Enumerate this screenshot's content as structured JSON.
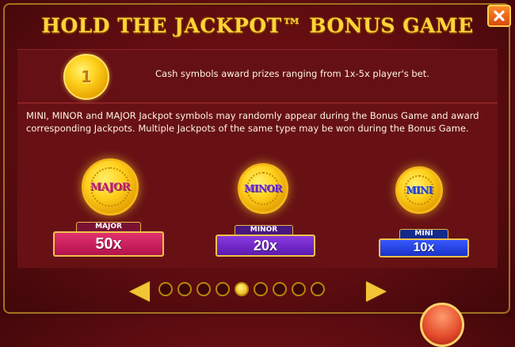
{
  "title": "HOLD THE JACKPOT™ BONUS GAME",
  "close_icon": "close-icon",
  "cash_coin": {
    "value": "1",
    "text": "Cash symbols award prizes ranging from 1x-5x player's bet."
  },
  "description": "MINI, MINOR and MAJOR Jackpot symbols may randomly appear during the Bonus Game and award corresponding Jackpots. Multiple Jackpots of the same type may be won during the Bonus Game.",
  "jackpots": [
    {
      "coin_label": "MAJOR",
      "tab_label": "MAJOR",
      "value": "50x",
      "color": "#c2185b"
    },
    {
      "coin_label": "MINOR",
      "tab_label": "MINOR",
      "value": "20x",
      "color": "#6a1fc2"
    },
    {
      "coin_label": "MINI",
      "tab_label": "MINI",
      "value": "10x",
      "color": "#1f3fd6"
    }
  ],
  "pagination": {
    "total": 9,
    "current": 5
  },
  "colors": {
    "title": "#ffd43a",
    "gold": "#f2c534",
    "background": "#5c0c10"
  }
}
